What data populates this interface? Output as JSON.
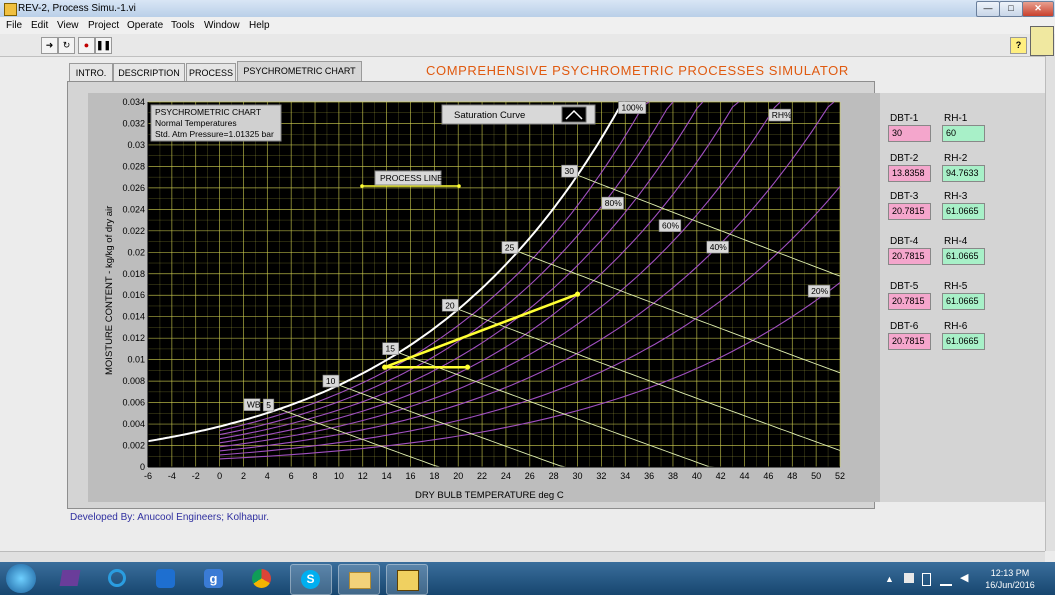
{
  "window": {
    "title": "REV-2, Process Simu.-1.vi"
  },
  "menu": [
    "File",
    "Edit",
    "View",
    "Project",
    "Operate",
    "Tools",
    "Window",
    "Help"
  ],
  "tabs": [
    "INTRO.",
    "DESCRIPTION",
    "PROCESS",
    "PSYCHROMETRIC CHART"
  ],
  "active_tab": "PSYCHROMETRIC CHART",
  "page_heading": "COMPREHENSIVE PSYCHROMETRIC PROCESSES SIMULATOR",
  "chart_data": {
    "type": "scatter",
    "info_lines": [
      "PSYCHROMETRIC CHART",
      "Normal Temperatures",
      "Std. Atm Pressure=1.01325 bar"
    ],
    "xlabel": "DRY BULB TEMPERATURE   deg C",
    "ylabel": "MOISTURE CONTENT - kg/kg of dry air",
    "xlim": [
      -6,
      52
    ],
    "ylim": [
      0,
      0.034
    ],
    "x_ticks": [
      "-6",
      "-4",
      "-2",
      "0",
      "2",
      "4",
      "6",
      "8",
      "10",
      "12",
      "14",
      "16",
      "18",
      "20",
      "22",
      "24",
      "26",
      "28",
      "30",
      "32",
      "34",
      "36",
      "38",
      "40",
      "42",
      "44",
      "46",
      "48",
      "50",
      "52"
    ],
    "y_ticks": [
      "0",
      "0.002",
      "0.004",
      "0.006",
      "0.008",
      "0.01",
      "0.012",
      "0.014",
      "0.016",
      "0.018",
      "0.02",
      "0.022",
      "0.024",
      "0.026",
      "0.028",
      "0.03",
      "0.032",
      "0.034"
    ],
    "legend_saturation": "Saturation Curve",
    "legend_process": "PROCESS LINE",
    "rh_header": "RH%",
    "wb_label": "WB",
    "wb_labels": [
      "5",
      "10",
      "15",
      "20",
      "25",
      "30"
    ],
    "rh_labels": [
      "100%",
      "80%",
      "60%",
      "40%",
      "20%"
    ],
    "series": [
      {
        "name": "PROCESS LINE",
        "color": "#ffff33",
        "points": [
          [
            30,
            0.0161
          ],
          [
            13.8358,
            0.0093
          ],
          [
            20.7815,
            0.0093
          ]
        ]
      }
    ],
    "grid": true,
    "background": "#000000",
    "grid_color": "#cfcf50",
    "saturation_color": "#ffffff",
    "rh_color": "#a050c0",
    "wb_color": "#e0f0b0"
  },
  "readouts": [
    {
      "dbt_label": "DBT-1",
      "dbt": "30",
      "rh_label": "RH-1",
      "rh": "60"
    },
    {
      "dbt_label": "DBT-2",
      "dbt": "13.8358",
      "rh_label": "RH-2",
      "rh": "94.7633"
    },
    {
      "dbt_label": "DBT-3",
      "dbt": "20.7815",
      "rh_label": "RH-3",
      "rh": "61.0665"
    },
    {
      "dbt_label": "DBT-4",
      "dbt": "20.7815",
      "rh_label": "RH-4",
      "rh": "61.0665"
    },
    {
      "dbt_label": "DBT-5",
      "dbt": "20.7815",
      "rh_label": "RH-5",
      "rh": "61.0665"
    },
    {
      "dbt_label": "DBT-6",
      "dbt": "20.7815",
      "rh_label": "RH-6",
      "rh": "61.0665"
    }
  ],
  "credit": "Developed By: Anucool Engineers; Kolhapur.",
  "taskbar": {
    "time": "12:13 PM",
    "date": "16/Jun/2016",
    "apps": [
      "start-orb-icon",
      "visual-studio-icon",
      "internet-explorer-icon",
      "teamviewer-icon",
      "google-search-icon",
      "chrome-icon",
      "skype-icon",
      "file-explorer-icon",
      "labview-icon"
    ]
  },
  "colors": {
    "heading": "#e05a10",
    "credit": "#3030a0",
    "dbt_field": "#f4a6cc",
    "rh_field": "#a8f0c8"
  }
}
